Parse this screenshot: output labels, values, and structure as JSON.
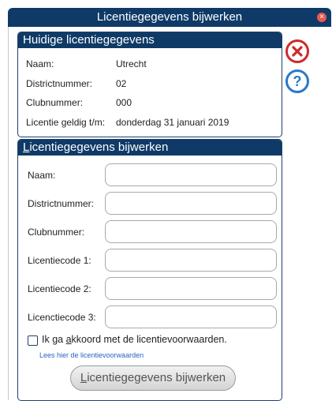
{
  "window": {
    "title": "Licentiegegevens bijwerken"
  },
  "current": {
    "heading": "Huidige licentiegegevens",
    "rows": [
      {
        "label": "Naam:",
        "value": "Utrecht"
      },
      {
        "label": "Districtnummer:",
        "value": "02"
      },
      {
        "label": "Clubnummer:",
        "value": "000"
      },
      {
        "label": "Licentie geldig t/m:",
        "value": "donderdag 31 januari 2019"
      }
    ]
  },
  "update": {
    "heading_first": "L",
    "heading_rest": "icentiegegevens bijwerken",
    "fields": [
      {
        "label": "Naam:",
        "value": ""
      },
      {
        "label": "Districtnummer:",
        "value": ""
      },
      {
        "label": "Clubnummer:",
        "value": ""
      },
      {
        "label": "Licentiecode 1:",
        "value": ""
      },
      {
        "label": "Licentiecode 2:",
        "value": ""
      },
      {
        "label": "Licenctiecode 3:",
        "value": ""
      }
    ],
    "agree_pre": "Ik ga ",
    "agree_underline": "a",
    "agree_post": "kkoord met de licentievoorwaarden.",
    "agree_checked": false,
    "terms_link": "Lees hier de licentievoorwaarden",
    "submit_first": "L",
    "submit_rest": "icentiegegevens bijwerken"
  },
  "icons": {
    "close": "close-circle-icon",
    "help": "help-circle-icon"
  },
  "colors": {
    "header": "#0f3a67",
    "close": "#cc2b2b",
    "help": "#2a78c8",
    "link": "#2a63c0"
  }
}
